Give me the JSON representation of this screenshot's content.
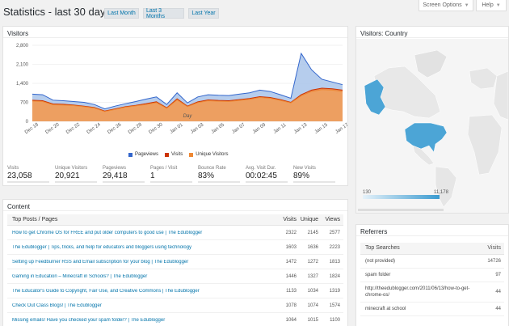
{
  "top_buttons": {
    "screen_options": "Screen Options",
    "help": "Help"
  },
  "title": "Statistics - last 30 days",
  "ranges": {
    "month": "Last Month",
    "three_months": "Last 3 Months",
    "year": "Last Year"
  },
  "visitors_panel": {
    "title": "Visitors",
    "stats": [
      {
        "label": "Visits",
        "value": "23,058"
      },
      {
        "label": "Unique Visitors",
        "value": "20,921"
      },
      {
        "label": "Pageviews",
        "value": "29,418"
      },
      {
        "label": "Pages / Visit",
        "value": "1"
      },
      {
        "label": "Bounce Rate",
        "value": "83%"
      },
      {
        "label": "Avg. Visit Dur.",
        "value": "00:02:45"
      },
      {
        "label": "New Visits",
        "value": "89%"
      }
    ]
  },
  "chart_data": {
    "type": "area",
    "xlabel": "Day",
    "ylabel": "",
    "ylim": [
      0,
      2800
    ],
    "yticks": [
      "0",
      "700",
      "1,400",
      "2,100",
      "2,800"
    ],
    "categories": [
      "Dec 18",
      "Dec 19",
      "Dec 20",
      "Dec 21",
      "Dec 22",
      "Dec 23",
      "Dec 24",
      "Dec 25",
      "Dec 26",
      "Dec 27",
      "Dec 28",
      "Dec 29",
      "Dec 30",
      "Dec 31",
      "Jan 01",
      "Jan 02",
      "Jan 03",
      "Jan 04",
      "Jan 05",
      "Jan 06",
      "Jan 07",
      "Jan 08",
      "Jan 09",
      "Jan 10",
      "Jan 11",
      "Jan 12",
      "Jan 13",
      "Jan 14",
      "Jan 15",
      "Jan 16",
      "Jan 17"
    ],
    "xtick_labels": [
      "Dec 18",
      "Dec 20",
      "Dec 22",
      "Dec 24",
      "Dec 26",
      "Dec 28",
      "Dec 30",
      "Jan 01",
      "Jan 03",
      "Jan 05",
      "Jan 07",
      "Jan 09",
      "Jan 11",
      "Jan 13",
      "Jan 15",
      "Jan 17"
    ],
    "series": [
      {
        "name": "Pageviews",
        "color": "#3366cc",
        "values": [
          1000,
          980,
          780,
          760,
          730,
          700,
          620,
          460,
          560,
          650,
          730,
          820,
          900,
          620,
          1050,
          680,
          900,
          980,
          960,
          950,
          1000,
          1050,
          1150,
          1100,
          980,
          850,
          2500,
          1900,
          1550,
          1450,
          1350
        ]
      },
      {
        "name": "Visits",
        "color": "#cc3300",
        "values": [
          780,
          760,
          640,
          630,
          600,
          560,
          510,
          380,
          460,
          540,
          590,
          650,
          720,
          500,
          830,
          560,
          720,
          790,
          770,
          760,
          800,
          840,
          910,
          880,
          800,
          700,
          980,
          1150,
          1220,
          1200,
          1150
        ]
      },
      {
        "name": "Unique Visitors",
        "color": "#ee8833",
        "values": [
          750,
          730,
          610,
          600,
          580,
          540,
          490,
          360,
          440,
          520,
          570,
          620,
          690,
          480,
          790,
          540,
          690,
          760,
          740,
          730,
          770,
          810,
          880,
          850,
          770,
          680,
          940,
          1100,
          1170,
          1150,
          1100
        ]
      }
    ]
  },
  "country_panel": {
    "title": "Visitors: Country",
    "scale_min": "130",
    "scale_max": "11,178"
  },
  "content_panel": {
    "title": "Content",
    "headers": {
      "title": "Top Posts / Pages",
      "visits": "Visits",
      "unique": "Unique",
      "views": "Views"
    },
    "rows": [
      {
        "title": "How to get Chrome OS for FREE and put older computers to good use | The Edublogger",
        "visits": "2322",
        "unique": "2145",
        "views": "2577"
      },
      {
        "title": "The Edublogger | Tips, tricks, and help for educators and bloggers using technology",
        "visits": "1603",
        "unique": "1636",
        "views": "2223"
      },
      {
        "title": "Setting up Feedburner RSS and Email subscription for your blog | The Edublogger",
        "visits": "1472",
        "unique": "1272",
        "views": "1813"
      },
      {
        "title": "Gaming in Education – Minecraft in Schools? | The Edublogger",
        "visits": "1446",
        "unique": "1327",
        "views": "1824"
      },
      {
        "title": "The Educator's Guide to Copyright, Fair Use, and Creative Commons | The Edublogger",
        "visits": "1133",
        "unique": "1034",
        "views": "1319"
      },
      {
        "title": "Check Out Class Blogs! | The Edublogger",
        "visits": "1078",
        "unique": "1074",
        "views": "1574"
      },
      {
        "title": "Missing emails! Have you checked your spam folder? | The Edublogger",
        "visits": "1064",
        "unique": "1015",
        "views": "1100"
      }
    ]
  },
  "referrers_panel": {
    "title": "Referrers",
    "headers": {
      "term": "Top Searches",
      "visits": "Visits"
    },
    "rows": [
      {
        "term": "(not provided)",
        "visits": "14726"
      },
      {
        "term": "spam folder",
        "visits": "97"
      },
      {
        "term": "http://theedublogger.com/2011/06/13/how-to-get-chrome-os/",
        "visits": "44"
      },
      {
        "term": "minecraft at school",
        "visits": "44"
      }
    ]
  }
}
